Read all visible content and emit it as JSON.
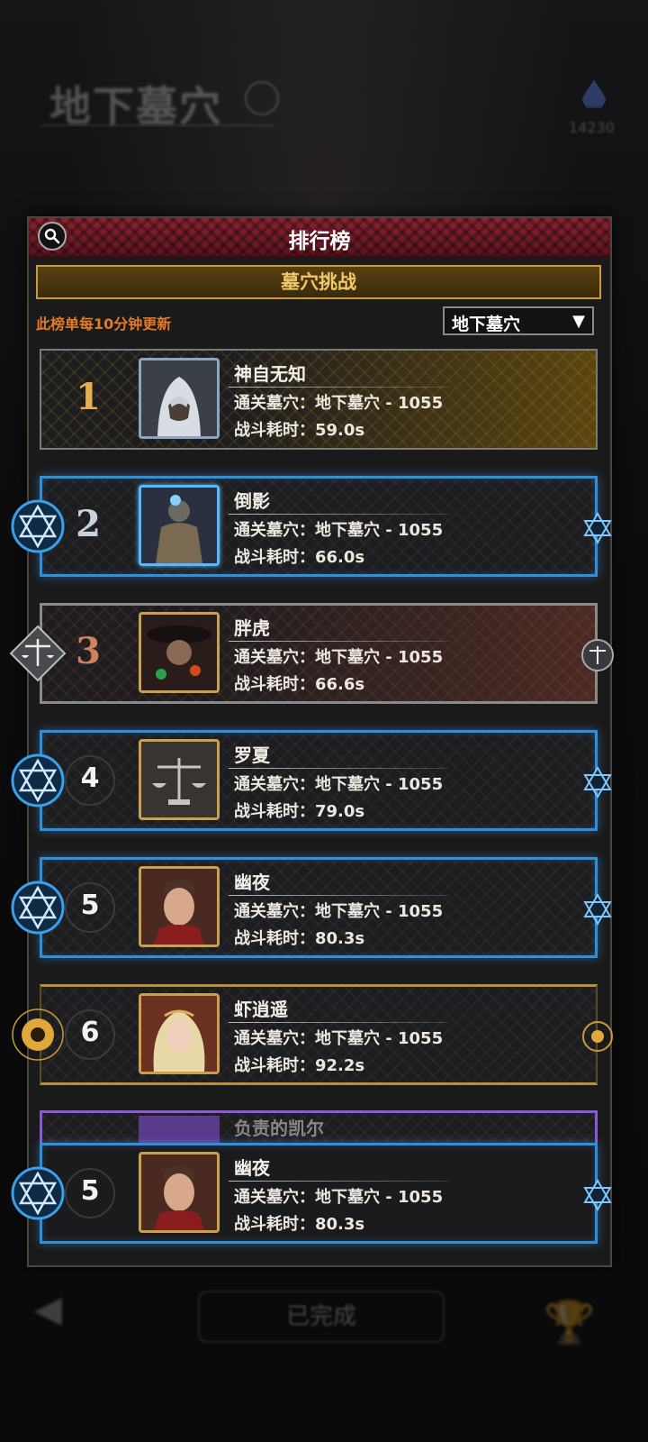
{
  "background": {
    "title": "地下墓穴",
    "currency_value": "14230",
    "done_button_label": "已完成"
  },
  "panel": {
    "title": "排行榜",
    "tab_label": "墓穴挑战",
    "update_note": "此榜单每10分钟更新",
    "filter": {
      "selected": "地下墓穴",
      "arrow": "▼"
    }
  },
  "entries": [
    {
      "rank": "1",
      "name": "神自无知",
      "cleared": "通关墓穴：地下墓穴 - 1055",
      "time": "战斗耗时：59.0s",
      "tier": "gold"
    },
    {
      "rank": "2",
      "name": "倒影",
      "cleared": "通关墓穴：地下墓穴 - 1055",
      "time": "战斗耗时：66.0s",
      "tier": "blue"
    },
    {
      "rank": "3",
      "name": "胖虎",
      "cleared": "通关墓穴：地下墓穴 - 1055",
      "time": "战斗耗时：66.6s",
      "tier": "bronze"
    },
    {
      "rank": "4",
      "name": "罗夏",
      "cleared": "通关墓穴：地下墓穴 - 1055",
      "time": "战斗耗时：79.0s",
      "tier": "blue"
    },
    {
      "rank": "5",
      "name": "幽夜",
      "cleared": "通关墓穴：地下墓穴 - 1055",
      "time": "战斗耗时：80.3s",
      "tier": "blue"
    },
    {
      "rank": "6",
      "name": "虾逍遥",
      "cleared": "通关墓穴：地下墓穴 - 1055",
      "time": "战斗耗时：92.2s",
      "tier": "sun"
    }
  ],
  "partial_entry": {
    "name": "负责的凯尔"
  },
  "my_entry": {
    "rank": "5",
    "name": "幽夜",
    "cleared": "通关墓穴：地下墓穴 - 1055",
    "time": "战斗耗时：80.3s",
    "tier": "blue"
  },
  "colors": {
    "header_red": "#8a2430",
    "tab_gold": "#f0c86a",
    "note_orange": "#e27a2a",
    "blue_frame": "#2f8fd8",
    "gold_rank": "#e3b04a"
  }
}
